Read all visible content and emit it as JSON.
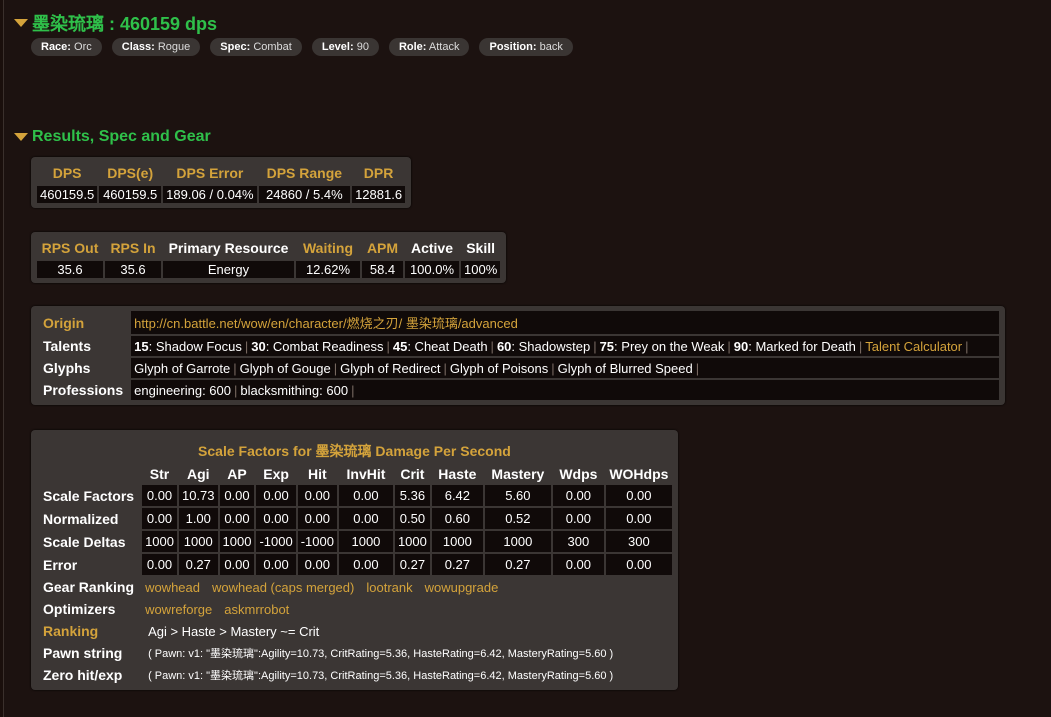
{
  "player": {
    "title": "墨染琉璃 : 460159 dps",
    "pills": [
      {
        "label": "Race:",
        "value": "Orc"
      },
      {
        "label": "Class:",
        "value": "Rogue"
      },
      {
        "label": "Spec:",
        "value": "Combat"
      },
      {
        "label": "Level:",
        "value": "90"
      },
      {
        "label": "Role:",
        "value": "Attack"
      },
      {
        "label": "Position:",
        "value": "back"
      }
    ]
  },
  "results": {
    "title": "Results, Spec and Gear",
    "dps_table": {
      "headers": [
        "DPS",
        "DPS(e)",
        "DPS Error",
        "DPS Range",
        "DPR"
      ],
      "values": [
        "460159.5",
        "460159.5",
        "189.06 / 0.04%",
        "24860 / 5.4%",
        "12881.6"
      ]
    },
    "rps_table": {
      "headers": [
        {
          "text": "RPS Out",
          "color": "gold"
        },
        {
          "text": "RPS In",
          "color": "gold"
        },
        {
          "text": "Primary Resource",
          "color": "white"
        },
        {
          "text": "Waiting",
          "color": "gold"
        },
        {
          "text": "APM",
          "color": "gold"
        },
        {
          "text": "Active",
          "color": "white"
        },
        {
          "text": "Skill",
          "color": "white"
        }
      ],
      "values": [
        "35.6",
        "35.6",
        "Energy",
        "12.62%",
        "58.4",
        "100.0%",
        "100%"
      ]
    },
    "origin": {
      "origin_label": "Origin",
      "origin_url": "http://cn.battle.net/wow/en/character/燃烧之刃/ 墨染琉璃/advanced",
      "talents_label": "Talents",
      "talents": [
        {
          "tier": "15",
          "name": ": Shadow Focus"
        },
        {
          "tier": "30",
          "name": ": Combat Readiness"
        },
        {
          "tier": "45",
          "name": ": Cheat Death"
        },
        {
          "tier": "60",
          "name": ": Shadowstep"
        },
        {
          "tier": "75",
          "name": ": Prey on the Weak"
        },
        {
          "tier": "90",
          "name": ": Marked for Death"
        }
      ],
      "talent_calc": "Talent Calculator",
      "glyphs_label": "Glyphs",
      "glyphs": [
        "Glyph of Garrote",
        "Glyph of Gouge",
        "Glyph of Redirect",
        "Glyph of Poisons",
        "Glyph of Blurred Speed"
      ],
      "professions_label": "Professions",
      "professions": [
        "engineering: 600",
        "blacksmithing: 600"
      ]
    },
    "scale": {
      "caption": "Scale Factors for 墨染琉璃 Damage Per Second",
      "columns": [
        "Str",
        "Agi",
        "AP",
        "Exp",
        "Hit",
        "InvHit",
        "Crit",
        "Haste",
        "Mastery",
        "Wdps",
        "WOHdps"
      ],
      "rows": [
        {
          "label": "Scale Factors",
          "values": [
            "0.00",
            "10.73",
            "0.00",
            "0.00",
            "0.00",
            "0.00",
            "5.36",
            "6.42",
            "5.60",
            "0.00",
            "0.00"
          ]
        },
        {
          "label": "Normalized",
          "values": [
            "0.00",
            "1.00",
            "0.00",
            "0.00",
            "0.00",
            "0.00",
            "0.50",
            "0.60",
            "0.52",
            "0.00",
            "0.00"
          ]
        },
        {
          "label": "Scale Deltas",
          "values": [
            "1000",
            "1000",
            "1000",
            "-1000",
            "-1000",
            "1000",
            "1000",
            "1000",
            "1000",
            "300",
            "300"
          ]
        },
        {
          "label": "Error",
          "values": [
            "0.00",
            "0.27",
            "0.00",
            "0.00",
            "0.00",
            "0.00",
            "0.27",
            "0.27",
            "0.27",
            "0.00",
            "0.00"
          ]
        }
      ],
      "gear_ranking_label": "Gear Ranking",
      "gear_ranking_links": [
        "wowhead",
        "wowhead (caps merged)",
        "lootrank",
        "wowupgrade"
      ],
      "optimizers_label": "Optimizers",
      "optimizers_links": [
        "wowreforge",
        "askmrrobot"
      ],
      "ranking_label": "Ranking",
      "ranking_value": "Agi > Haste > Mastery ~= Crit",
      "pawn_label": "Pawn string",
      "pawn_value": "( Pawn: v1: \"墨染琉璃\":Agility=10.73, CritRating=5.36, HasteRating=6.42, MasteryRating=5.60 )",
      "zero_label": "Zero hit/exp",
      "zero_value": "( Pawn: v1: \"墨染琉璃\":Agility=10.73, CritRating=5.36, HasteRating=6.42, MasteryRating=5.60 )"
    }
  },
  "colors": {
    "accent_green": "#2fc04a",
    "accent_gold": "#d4a33b",
    "panel": "#3b3634",
    "cell": "#100a09"
  }
}
